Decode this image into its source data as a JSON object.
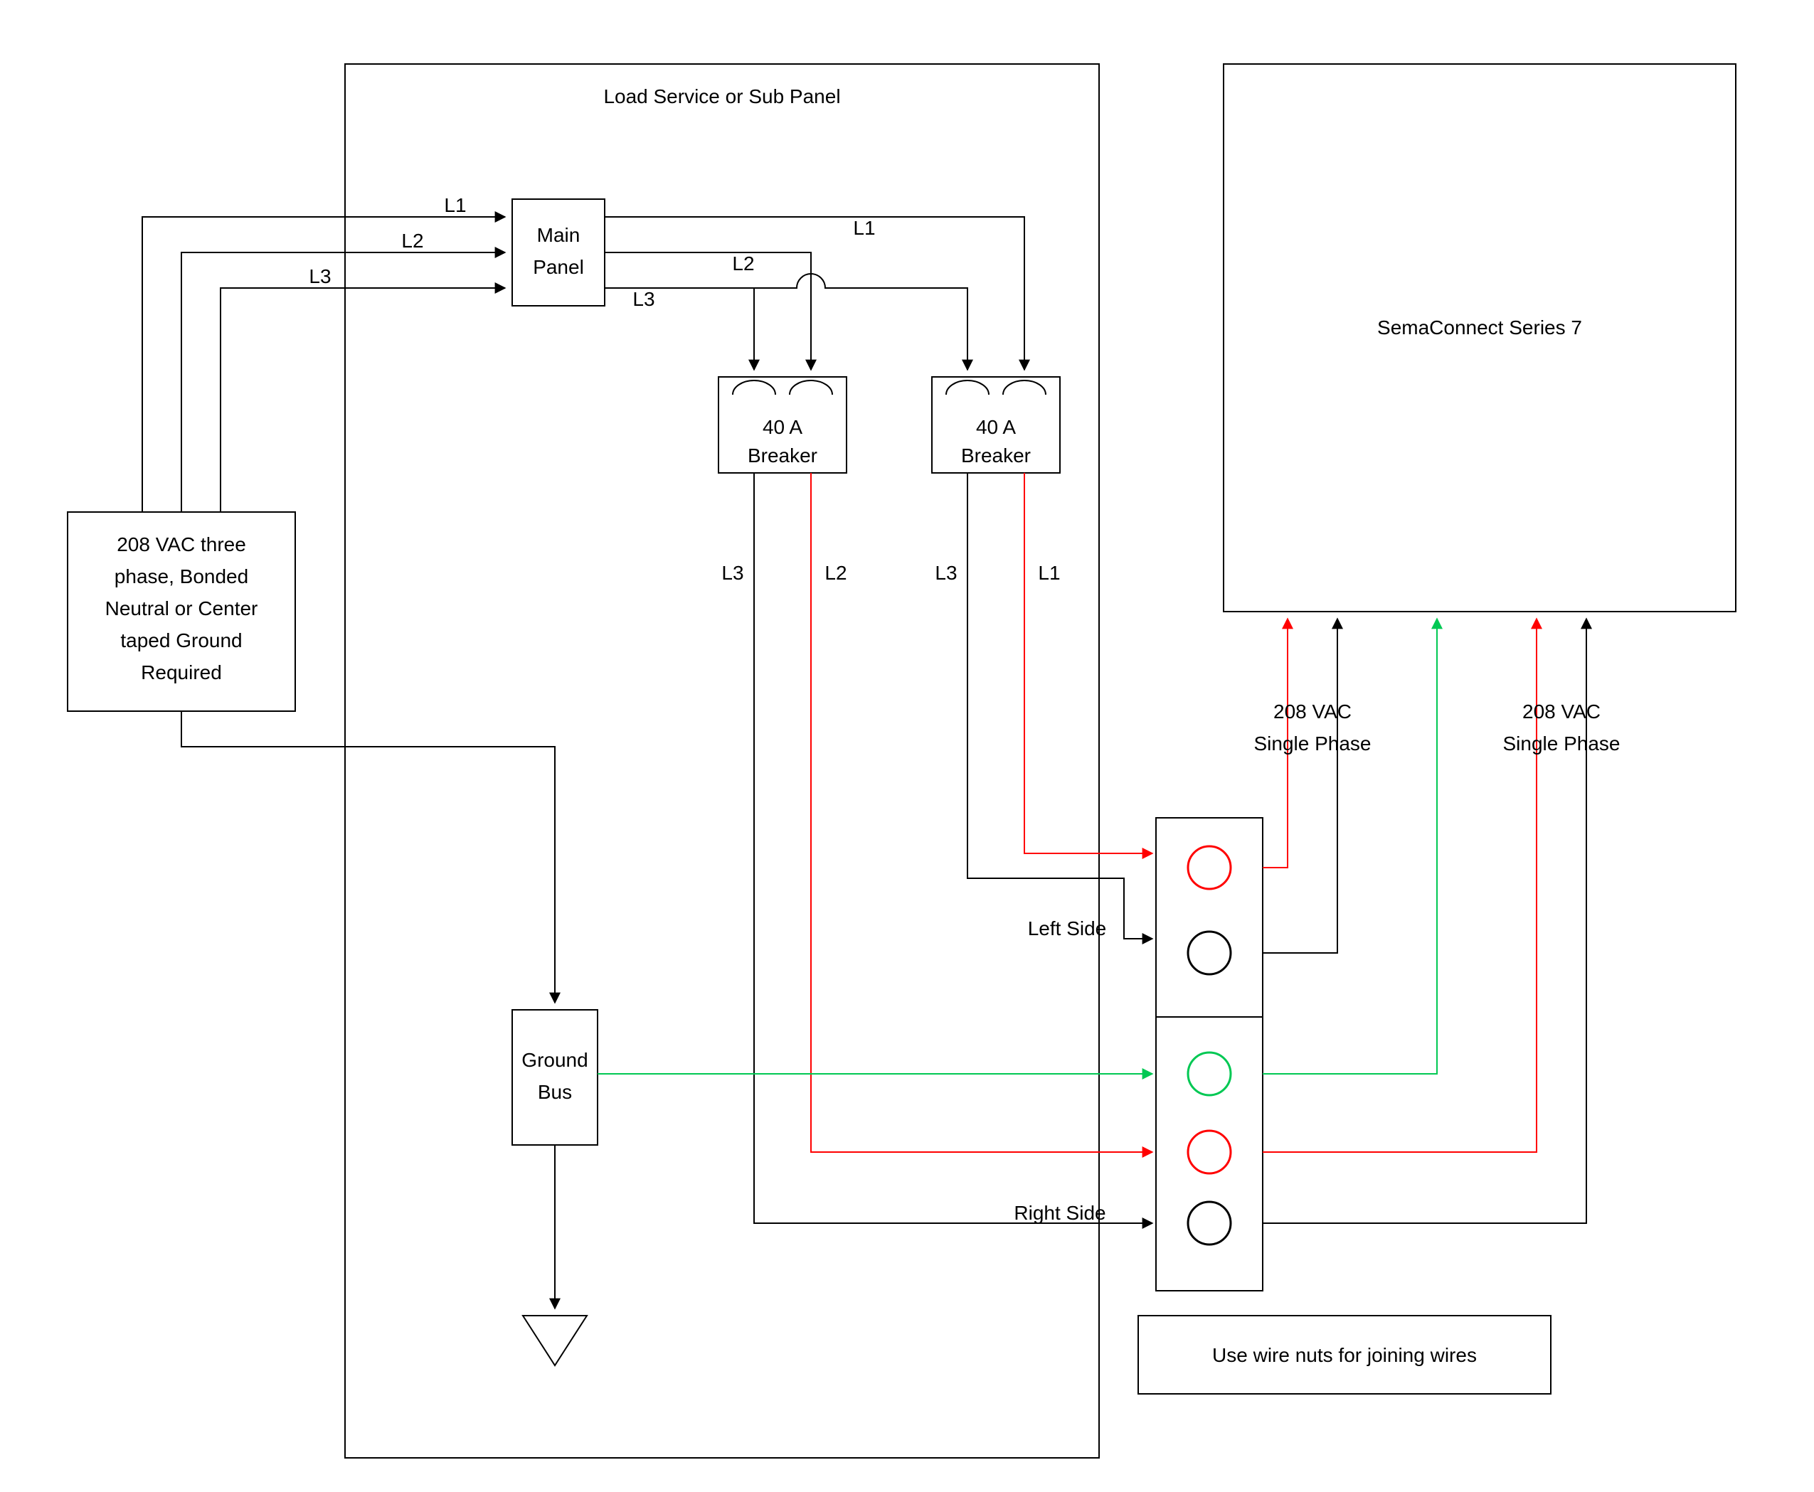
{
  "source_box": {
    "line1": "208 VAC three",
    "line2": "phase, Bonded",
    "line3": "Neutral or Center",
    "line4": "taped Ground",
    "line5": "Required"
  },
  "panel_title": "Load Service or Sub Panel",
  "main_panel": {
    "line1": "Main",
    "line2": "Panel"
  },
  "breaker1": {
    "line1": "40 A",
    "line2": "Breaker"
  },
  "breaker2": {
    "line1": "40 A",
    "line2": "Breaker"
  },
  "ground_bus": {
    "line1": "Ground",
    "line2": "Bus"
  },
  "labels": {
    "L1_in": "L1",
    "L2_in": "L2",
    "L3_in": "L3",
    "L1_top": "L1",
    "L2_top": "L2",
    "L3_top": "L3",
    "b1_L3": "L3",
    "b1_L2": "L2",
    "b2_L3": "L3",
    "b2_L1": "L1",
    "left_side": "Left Side",
    "right_side": "Right Side",
    "phase1": {
      "line1": "208 VAC",
      "line2": "Single Phase"
    },
    "phase2": {
      "line1": "208 VAC",
      "line2": "Single Phase"
    }
  },
  "device": "SemaConnect Series 7",
  "wire_nuts": "Use wire nuts for joining wires",
  "colors": {
    "red": "#ff0000",
    "green": "#00c853",
    "black": "#000000"
  }
}
